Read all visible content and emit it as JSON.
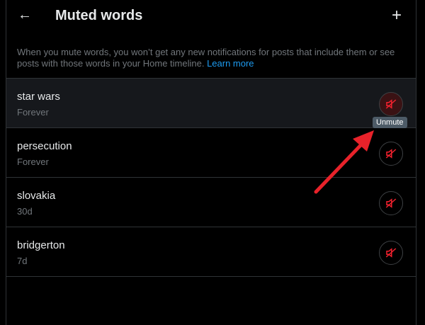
{
  "header": {
    "title": "Muted words",
    "back_icon": "arrow-left-icon",
    "add_icon": "plus-icon"
  },
  "description": {
    "text": "When you mute words, you won’t get any new notifications for posts that include them or see posts with those words in your Home timeline. ",
    "link": "Learn more"
  },
  "items": [
    {
      "word": "star wars",
      "duration": "Forever"
    },
    {
      "word": "persecution",
      "duration": "Forever"
    },
    {
      "word": "slovakia",
      "duration": "30d"
    },
    {
      "word": "bridgerton",
      "duration": "7d"
    }
  ],
  "tooltip": "Unmute",
  "colors": {
    "accent": "#1d9bf0",
    "unmute": "#f4212e",
    "annotation": "#e8222a"
  }
}
